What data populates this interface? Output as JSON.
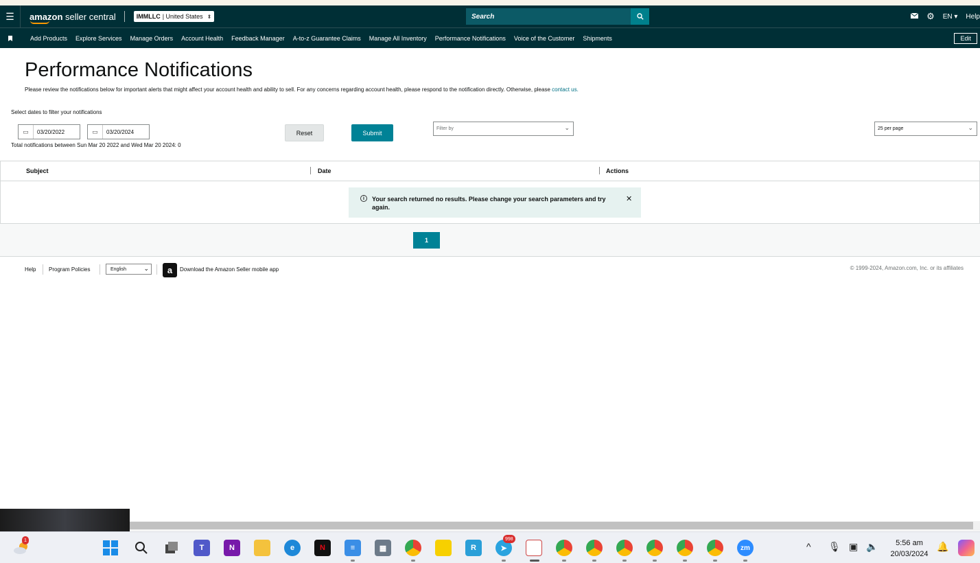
{
  "header": {
    "logo_text_amazon": "amazon",
    "logo_text_rest": " seller central",
    "account_bold": "IMMLLC",
    "account_rest": "| United States",
    "search_placeholder": "Search",
    "lang": "EN ▾",
    "help": "Help"
  },
  "nav": {
    "items": [
      "Add Products",
      "Explore Services",
      "Manage Orders",
      "Account Health",
      "Feedback Manager",
      "A-to-z Guarantee Claims",
      "Manage All Inventory",
      "Performance Notifications",
      "Voice of the Customer",
      "Shipments"
    ],
    "edit": "Edit"
  },
  "page": {
    "title": "Performance Notifications",
    "description": "Please review the notifications below for important alerts that might affect your account health and ability to sell. For any concerns regarding account health, please respond to the notification directly. Otherwise, please ",
    "contact_link": "contact us.",
    "filter_label": "Select dates to filter your notifications",
    "date_from": "03/20/2022",
    "date_to": "03/20/2024",
    "reset": "Reset",
    "submit": "Submit",
    "filter_by_placeholder": "Filter by",
    "per_page": "25 per page",
    "total": "Total notifications between Sun Mar 20 2022 and Wed Mar 20 2024: 0"
  },
  "table": {
    "columns": [
      "Subject",
      "Date",
      "Actions"
    ],
    "empty_message": "Your search returned no results. Please change your search parameters and try again."
  },
  "pagination": {
    "current": "1"
  },
  "footer": {
    "help": "Help",
    "policies": "Program Policies",
    "language": "English",
    "app_link": "Download the Amazon Seller mobile app",
    "copyright": "© 1999-2024, Amazon.com, Inc. or its affiliates"
  },
  "taskbar": {
    "weather_badge": "1",
    "telegram_badge": "998",
    "time": "5:56 am",
    "date": "20/03/2024"
  },
  "colors": {
    "header_bg": "#002f36",
    "accent": "#008296",
    "alert_bg": "#e6f2f0"
  }
}
